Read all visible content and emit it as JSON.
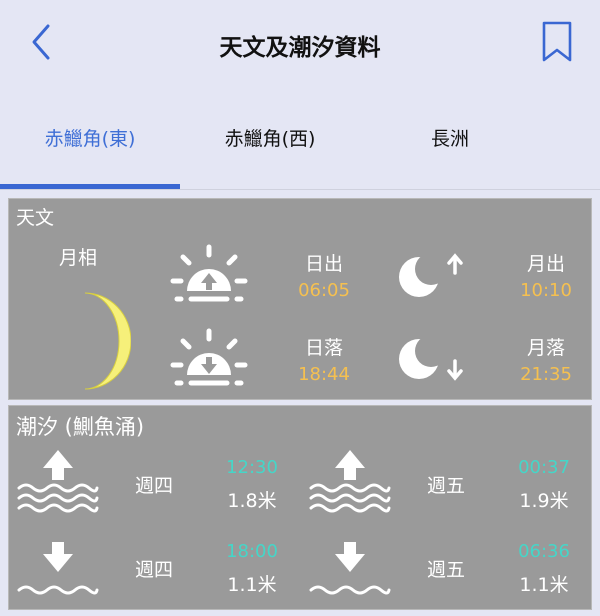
{
  "header": {
    "title": "天文及潮汐資料"
  },
  "tabs": [
    {
      "label": "赤鱲角(東)",
      "active": true
    },
    {
      "label": "赤鱲角(西)",
      "active": false
    },
    {
      "label": "長洲",
      "active": false
    }
  ],
  "astronomy": {
    "title": "天文",
    "moon_phase_label": "月相",
    "sunrise": {
      "label": "日出",
      "time": "06:05"
    },
    "sunset": {
      "label": "日落",
      "time": "18:44"
    },
    "moonrise": {
      "label": "月出",
      "time": "10:10"
    },
    "moonset": {
      "label": "月落",
      "time": "21:35"
    }
  },
  "tide": {
    "title": "潮汐 (鰂魚涌)",
    "entries": [
      {
        "type": "high",
        "day": "週四",
        "time": "12:30",
        "height": "1.8米"
      },
      {
        "type": "high",
        "day": "週五",
        "time": "00:37",
        "height": "1.9米"
      },
      {
        "type": "low",
        "day": "週四",
        "time": "18:00",
        "height": "1.1米"
      },
      {
        "type": "low",
        "day": "週五",
        "time": "06:36",
        "height": "1.1米"
      }
    ]
  },
  "colors": {
    "accent": "#3a67d2",
    "panel": "#9a9a9a",
    "time_orange": "#f5c050",
    "time_teal": "#45d6c8"
  }
}
